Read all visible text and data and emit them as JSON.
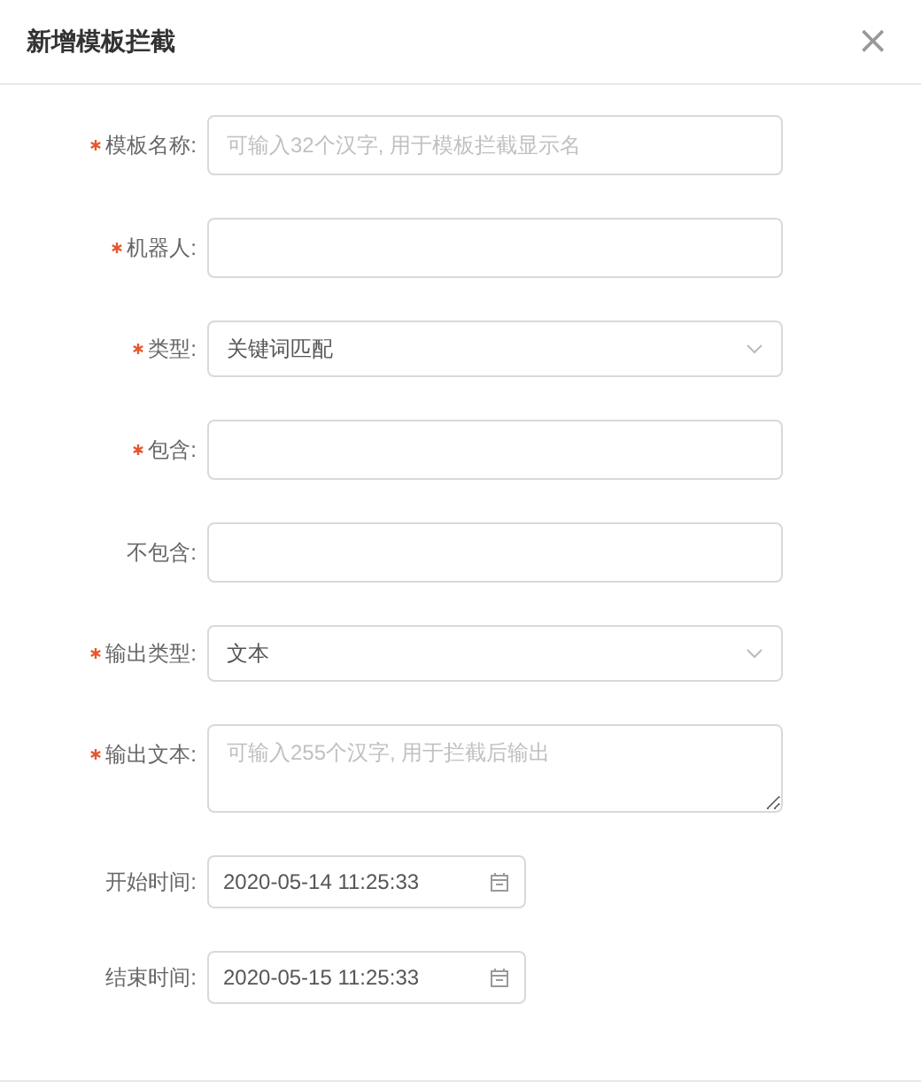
{
  "dialog": {
    "title": "新增模板拦截",
    "close": "×"
  },
  "fields": [
    {
      "kind": "input",
      "label": "模板名称:",
      "required": true,
      "placeholder": "可输入32个汉字, 用于模板拦截显示名"
    },
    {
      "kind": "input",
      "label": "机器人:",
      "required": true
    },
    {
      "kind": "select",
      "label": "类型:",
      "required": true,
      "value": "关键词匹配"
    },
    {
      "kind": "input",
      "label": "包含:",
      "required": true
    },
    {
      "kind": "input",
      "label": "不包含:",
      "required": false
    },
    {
      "kind": "select",
      "label": "输出类型:",
      "required": true,
      "value": "文本"
    },
    {
      "kind": "textarea",
      "label": "输出文本:",
      "required": true,
      "placeholder": "可输入255个汉字, 用于拦截后输出"
    },
    {
      "kind": "date",
      "label": "开始时间:",
      "required": false,
      "value": "2020-05-14 11:25:33"
    },
    {
      "kind": "date",
      "label": "结束时间:",
      "required": false,
      "value": "2020-05-15 11:25:33"
    }
  ]
}
